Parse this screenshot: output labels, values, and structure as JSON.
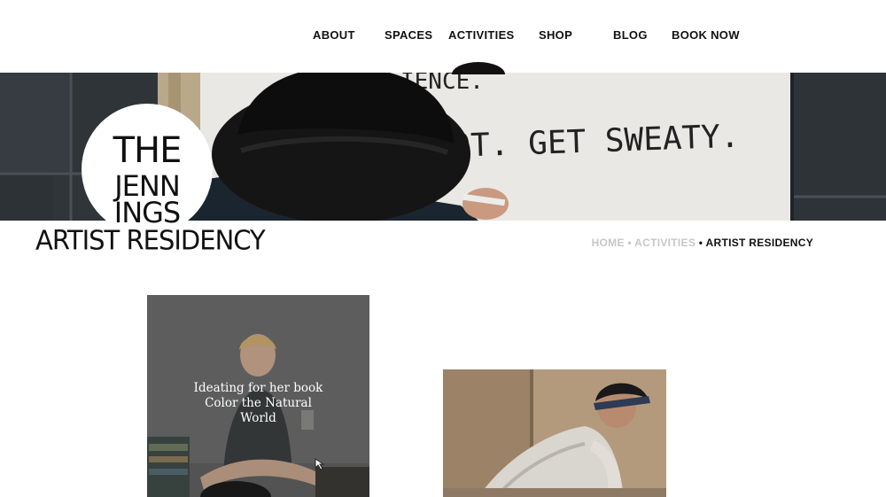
{
  "nav": {
    "items": [
      {
        "label": "ABOUT"
      },
      {
        "label": "SPACES"
      },
      {
        "label": "ACTIVITIES"
      },
      {
        "label": "SHOP"
      },
      {
        "label": "BLOG"
      },
      {
        "label": "BOOK NOW"
      }
    ]
  },
  "hero": {
    "sign_line_1": "IENCE.",
    "sign_line_2": "OT. GET SWEATY."
  },
  "logo": {
    "line1": "THE",
    "line2": "JENN",
    "line3": "INGS"
  },
  "page": {
    "title": "ARTIST RESIDENCY"
  },
  "breadcrumb": {
    "home": "HOME",
    "activities": "ACTIVITIES",
    "current": "ARTIST RESIDENCY",
    "separator": "•"
  },
  "gallery": {
    "items": [
      {
        "caption_lines": [
          "Ideating for her book",
          "Color the Natural",
          "World"
        ]
      },
      {
        "caption_lines": []
      }
    ]
  },
  "colors": {
    "breadcrumb_inactive": "#c7c7c7",
    "text": "#111111",
    "background": "#ffffff"
  }
}
